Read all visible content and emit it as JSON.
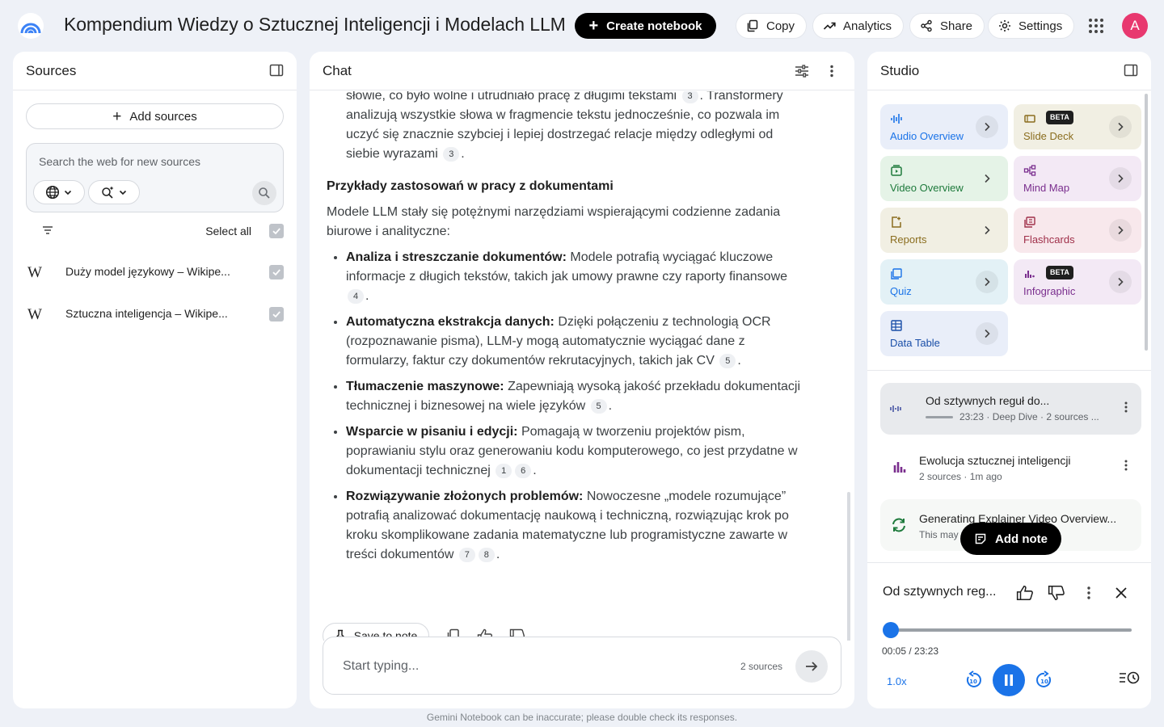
{
  "header": {
    "title": "Kompendium Wiedzy o Sztucznej Inteligencji i Modelach LLM",
    "create_label": "Create notebook",
    "copy_label": "Copy",
    "analytics_label": "Analytics",
    "share_label": "Share",
    "settings_label": "Settings",
    "avatar_letter": "A"
  },
  "sources": {
    "title": "Sources",
    "add_label": "Add sources",
    "search_placeholder": "Search the web for new sources",
    "select_all_label": "Select all",
    "items": [
      {
        "label": "Duży model językowy – Wikipe...",
        "checked": true
      },
      {
        "label": "Sztuczna inteligencja – Wikipe...",
        "checked": true
      }
    ]
  },
  "chat": {
    "title": "Chat",
    "para1_a": "słowie, co było wolne i utrudniało pracę z długimi tekstami",
    "para1_c1": "3",
    "para1_b": ". Transformery analizują wszystkie słowa w fragmencie tekstu jednocześnie, co pozwala im uczyć się znacznie szybciej i lepiej dostrzegać relacje między odległymi od siebie wyrazami",
    "para1_c2": "3",
    "heading": "Przykłady zastosowań w pracy z dokumentami",
    "intro": "Modele LLM stały się potężnymi narzędziami wspierającymi codzienne zadania biurowe i analityczne:",
    "bullets": [
      {
        "bold": "Analiza i streszczanie dokumentów:",
        "text": " Modele potrafią wyciągać kluczowe informacje z długich tekstów, takich jak umowy prawne czy raporty finansowe",
        "cites": [
          "4"
        ]
      },
      {
        "bold": "Automatyczna ekstrakcja danych:",
        "text": " Dzięki połączeniu z technologią OCR (rozpoznawanie pisma), LLM-y mogą automatycznie wyciągać dane z formularzy, faktur czy dokumentów rekrutacyjnych, takich jak CV",
        "cites": [
          "5"
        ]
      },
      {
        "bold": "Tłumaczenie maszynowe:",
        "text": " Zapewniają wysoką jakość przekładu dokumentacji technicznej i biznesowej na wiele języków",
        "cites": [
          "5"
        ]
      },
      {
        "bold": "Wsparcie w pisaniu i edycji:",
        "text": " Pomagają w tworzeniu projektów pism, poprawianiu stylu oraz generowaniu kodu komputerowego, co jest przydatne w dokumentacji technicznej",
        "cites": [
          "1",
          "6"
        ]
      },
      {
        "bold": "Rozwiązywanie złożonych problemów:",
        "text": " Nowoczesne „modele rozumujące” potrafią analizować dokumentację naukową i techniczną, rozwiązując krok po kroku skomplikowane zadania matematyczne lub programistyczne zawarte w treści dokumentów",
        "cites": [
          "7",
          "8"
        ]
      }
    ],
    "save_note_label": "Save to note",
    "input_placeholder": "Start typing...",
    "source_count": "2 sources"
  },
  "studio": {
    "title": "Studio",
    "tiles": [
      {
        "label": "Audio Overview",
        "color": "#1a73e8"
      },
      {
        "label": "Slide Deck",
        "color": "#8a6d1e",
        "badge": "BETA"
      },
      {
        "label": "Video Overview",
        "color": "#1e7a3c"
      },
      {
        "label": "Mind Map",
        "color": "#7a2e8e"
      },
      {
        "label": "Reports",
        "color": "#8a6d1e"
      },
      {
        "label": "Flashcards",
        "color": "#a0304a"
      },
      {
        "label": "Quiz",
        "color": "#1a73e8"
      },
      {
        "label": "Infographic",
        "color": "#7a2e8e",
        "badge": "BETA"
      },
      {
        "label": "Data Table",
        "color": "#1a4fa8"
      }
    ],
    "notes": [
      {
        "title": "Od sztywnych reguł do...",
        "sub": "23:23 · Deep Dive · 2 sources ..."
      },
      {
        "title": "Ewolucja sztucznej inteligencji",
        "sub": "2 sources · 1m ago"
      },
      {
        "title": "Generating Explainer Video Overview...",
        "sub": "This may take a few minutes"
      }
    ],
    "add_note_label": "Add note",
    "player": {
      "title": "Od sztywnych reg...",
      "time": "00:05 / 23:23",
      "speed": "1.0x",
      "progress": 0.0036
    }
  },
  "footer": "Gemini Notebook can be inaccurate; please double check its responses."
}
